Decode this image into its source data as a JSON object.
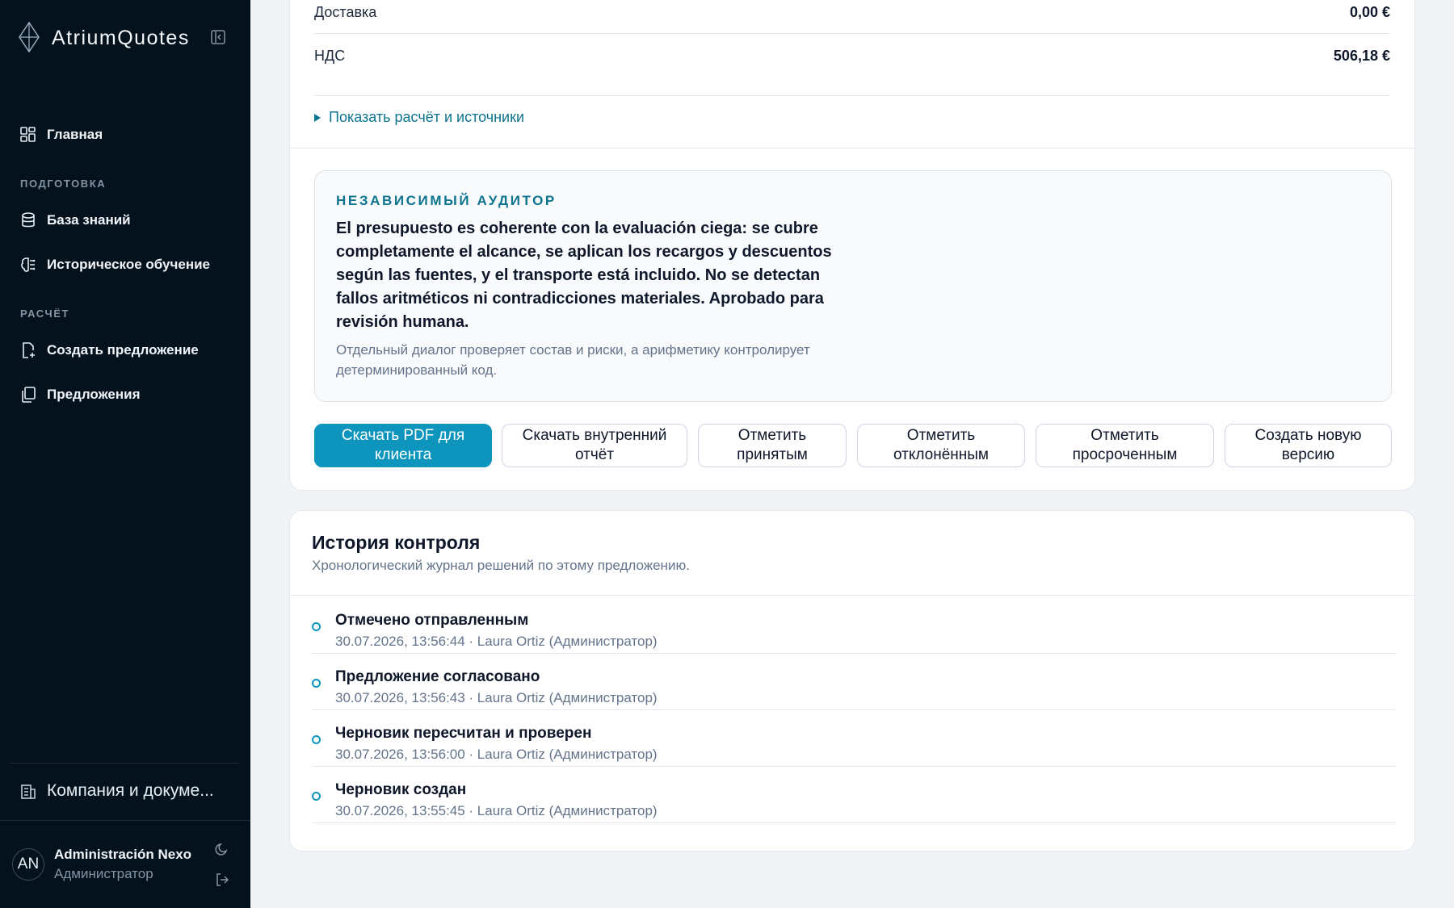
{
  "app": {
    "name": "AtriumQuotes"
  },
  "sidebar": {
    "home": "Главная",
    "section_prep": "ПОДГОТОВКА",
    "knowledge": "База знаний",
    "history_learning": "Историческое обучение",
    "section_calc": "РАСЧЁТ",
    "create_offer": "Создать предложение",
    "offers": "Предложения",
    "company": "Компания и докуме...",
    "user": {
      "initials": "AN",
      "name": "Administración Nexo",
      "role": "Администратор"
    }
  },
  "summary": {
    "rows": [
      {
        "label": "Доставка",
        "value": "0,00 €"
      },
      {
        "label": "НДС",
        "value": "506,18 €"
      }
    ],
    "show_calc": "Показать расчёт и источники"
  },
  "auditor": {
    "title": "НЕЗАВИСИМЫЙ АУДИТОР",
    "verdict": "El presupuesto es coherente con la evaluación ciega: se cubre completamente el alcance, se aplican los recargos y descuentos según las fuentes, y el transporte está incluido. No se detectan fallos aritméticos ni contradicciones materiales. Aprobado para revisión humana.",
    "note": "Отдельный диалог проверяет состав и риски, а арифметику контролирует детерминированный код."
  },
  "actions": {
    "download_pdf": "Скачать PDF для клиента",
    "download_internal": "Скачать внутренний отчёт",
    "mark_accepted": "Отметить принятым",
    "mark_rejected": "Отметить отклонённым",
    "mark_expired": "Отметить просроченным",
    "new_version": "Создать новую версию"
  },
  "history": {
    "title": "История контроля",
    "subtitle": "Хронологический журнал решений по этому предложению.",
    "items": [
      {
        "label": "Отмечено отправленным",
        "meta": "30.07.2026, 13:56:44 · Laura Ortiz (Администратор)"
      },
      {
        "label": "Предложение согласовано",
        "meta": "30.07.2026, 13:56:43 · Laura Ortiz (Администратор)"
      },
      {
        "label": "Черновик пересчитан и проверен",
        "meta": "30.07.2026, 13:56:00 · Laura Ortiz (Администратор)"
      },
      {
        "label": "Черновик создан",
        "meta": "30.07.2026, 13:55:45 · Laura Ortiz (Администратор)"
      }
    ]
  },
  "colors": {
    "sidebar_bg": "#03121d",
    "accent": "#0e95bd",
    "link": "#0e7490"
  }
}
